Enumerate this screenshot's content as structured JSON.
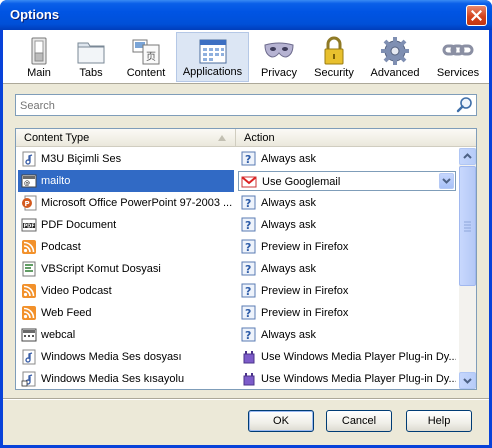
{
  "window": {
    "title": "Options"
  },
  "toolbar": {
    "items": [
      {
        "label": "Main",
        "icon": "main-switch-icon"
      },
      {
        "label": "Tabs",
        "icon": "tabs-folder-icon"
      },
      {
        "label": "Content",
        "icon": "content-icon"
      },
      {
        "label": "Applications",
        "icon": "applications-icon",
        "selected": true
      },
      {
        "label": "Privacy",
        "icon": "privacy-mask-icon"
      },
      {
        "label": "Security",
        "icon": "security-lock-icon"
      },
      {
        "label": "Advanced",
        "icon": "advanced-gear-icon"
      },
      {
        "label": "Services",
        "icon": "services-chain-icon"
      }
    ]
  },
  "search": {
    "placeholder": "Search"
  },
  "table": {
    "columns": [
      "Content Type",
      "Action"
    ],
    "rows": [
      {
        "type": "M3U Biçimli Ses",
        "type_icon": "audio-file-icon",
        "action": "Always ask",
        "action_icon": "ask-icon"
      },
      {
        "type": "mailto",
        "type_icon": "mailto-icon",
        "action": "Use Googlemail",
        "action_icon": "gmail-icon",
        "selected": true
      },
      {
        "type": "Microsoft Office PowerPoint 97-2003 ...",
        "type_icon": "powerpoint-icon",
        "action": "Always ask",
        "action_icon": "ask-icon"
      },
      {
        "type": "PDF Document",
        "type_icon": "pdf-icon",
        "action": "Always ask",
        "action_icon": "ask-icon"
      },
      {
        "type": "Podcast",
        "type_icon": "feed-icon",
        "action": "Preview in Firefox",
        "action_icon": "ask-icon"
      },
      {
        "type": "VBScript Komut Dosyasi",
        "type_icon": "vbscript-icon",
        "action": "Always ask",
        "action_icon": "ask-icon"
      },
      {
        "type": "Video Podcast",
        "type_icon": "feed-icon",
        "action": "Preview in Firefox",
        "action_icon": "ask-icon"
      },
      {
        "type": "Web Feed",
        "type_icon": "feed-icon",
        "action": "Preview in Firefox",
        "action_icon": "ask-icon"
      },
      {
        "type": "webcal",
        "type_icon": "calendar-icon",
        "action": "Always ask",
        "action_icon": "ask-icon"
      },
      {
        "type": "Windows Media Ses dosyası",
        "type_icon": "audio-file-icon",
        "action": "Use Windows Media Player Plug-in Dy...",
        "action_icon": "plugin-icon"
      },
      {
        "type": "Windows Media Ses kısayolu",
        "type_icon": "audio-shortcut-icon",
        "action": "Use Windows Media Player Plug-in Dy...",
        "action_icon": "plugin-icon"
      }
    ]
  },
  "buttons": {
    "ok": "OK",
    "cancel": "Cancel",
    "help": "Help"
  },
  "colors": {
    "titlebar": "#0054e3",
    "selection": "#316ac5",
    "dialog_bg": "#ece9d8"
  }
}
